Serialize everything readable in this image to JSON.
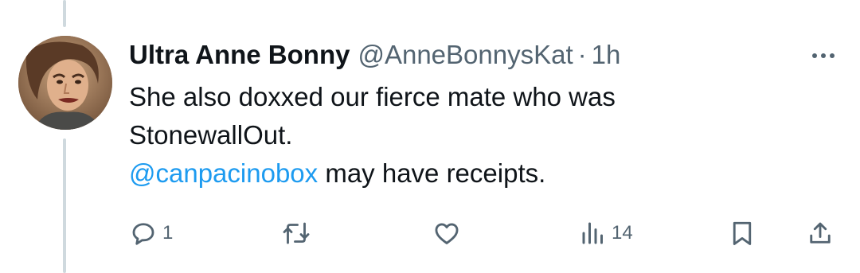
{
  "tweet": {
    "display_name": "Ultra Anne Bonny",
    "handle": "@AnneBonnysKat",
    "separator": "·",
    "time": "1h",
    "text_line1": "She also doxxed our fierce mate who was",
    "text_line2": "StonewallOut.",
    "mention": "@canpacinobox",
    "text_line3_rest": " may have receipts."
  },
  "actions": {
    "reply_count": "1",
    "retweet_count": "",
    "like_count": "",
    "views_count": "14"
  },
  "icons": {
    "more": "more-dots-icon",
    "reply": "reply-icon",
    "retweet": "retweet-icon",
    "like": "heart-icon",
    "views": "views-chart-icon",
    "bookmark": "bookmark-icon",
    "share": "share-icon"
  },
  "colors": {
    "text": "#0f1419",
    "secondary": "#536471",
    "link": "#1d9bf0",
    "thread_line": "#cfd9de"
  }
}
